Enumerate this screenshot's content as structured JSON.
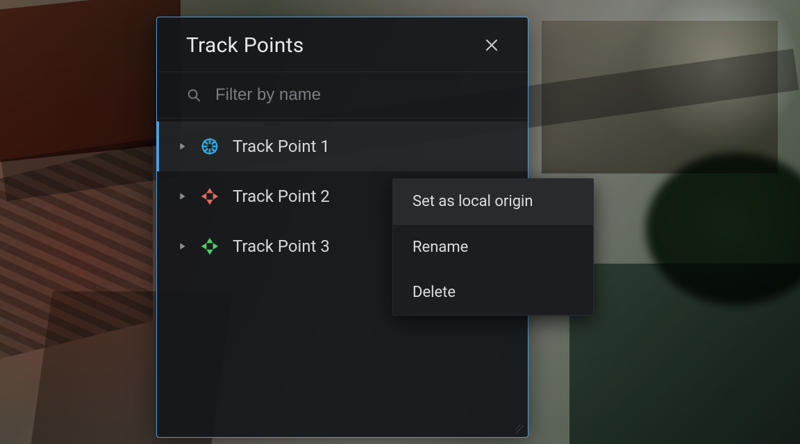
{
  "panel": {
    "title": "Track Points",
    "filter": {
      "placeholder": "Filter by name",
      "value": ""
    }
  },
  "items": [
    {
      "label": "Track Point 1",
      "selected": true,
      "color": "#2ea6df",
      "marker": "reticle-circle"
    },
    {
      "label": "Track Point 2",
      "selected": false,
      "color": "#e26b5c",
      "marker": "reticle-plus"
    },
    {
      "label": "Track Point 3",
      "selected": false,
      "color": "#4fcf6b",
      "marker": "reticle-plus"
    }
  ],
  "context_menu": {
    "items": [
      {
        "label": "Set as local origin",
        "highlight": true
      },
      {
        "label": "Rename",
        "highlight": false
      },
      {
        "label": "Delete",
        "highlight": false
      }
    ]
  }
}
